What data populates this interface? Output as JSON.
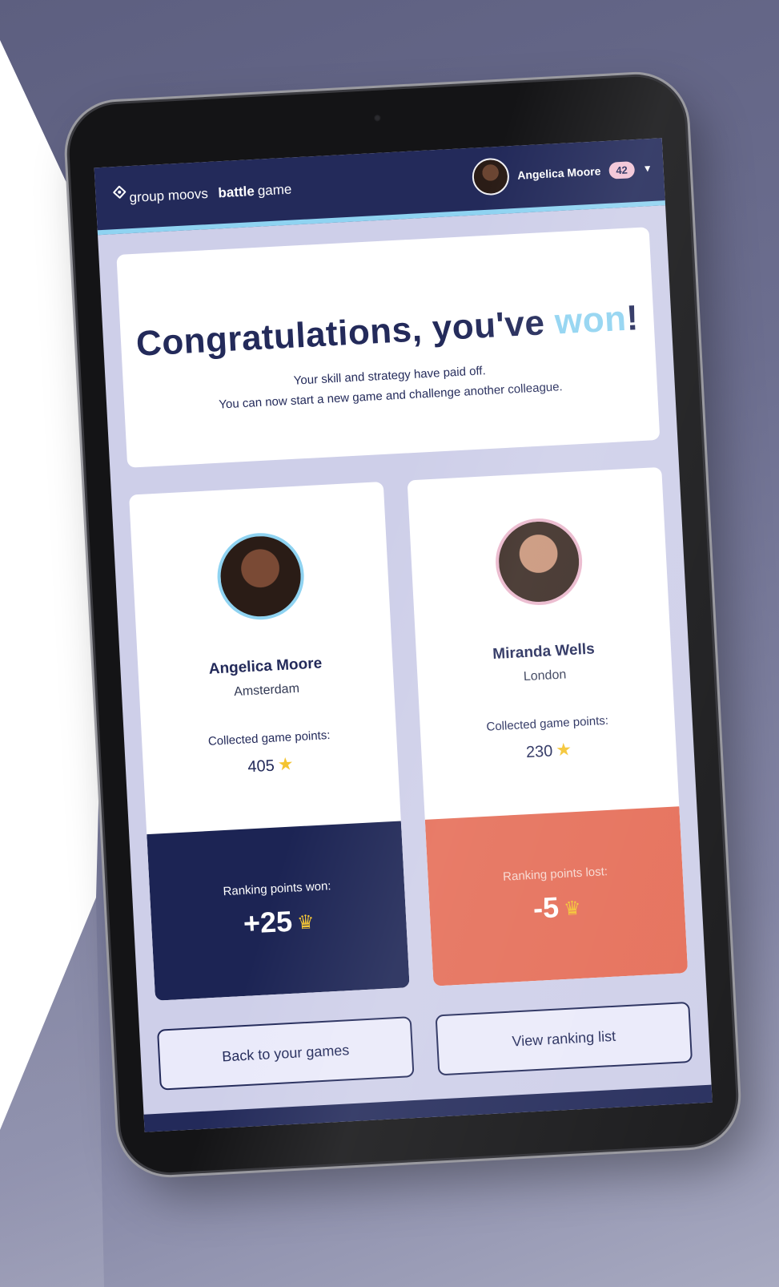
{
  "header": {
    "logo_prefix": "group moovs",
    "logo_bold": "battle",
    "logo_suffix": "game",
    "user_name": "Angelica Moore",
    "badge_count": "42"
  },
  "hero": {
    "title_main": "Congratulations, you've ",
    "title_accent": "won",
    "title_end": "!",
    "subtitle_line1": "Your skill and strategy have paid off.",
    "subtitle_line2": "You can now start a new game and challenge another colleague."
  },
  "players": [
    {
      "name": "Angelica Moore",
      "city": "Amsterdam",
      "points_label": "Collected game points:",
      "points_value": "405",
      "ranking_label": "Ranking points won:",
      "ranking_value": "+25"
    },
    {
      "name": "Miranda Wells",
      "city": "London",
      "points_label": "Collected game points:",
      "points_value": "230",
      "ranking_label": "Ranking points lost:",
      "ranking_value": "-5"
    }
  ],
  "buttons": {
    "back_label": "Back to your games",
    "ranking_label": "View ranking list"
  },
  "icons": {
    "points": "star-icon",
    "ranking": "crown-icon",
    "user_menu": "chevron-down-icon"
  },
  "colors": {
    "navy": "#232a5a",
    "accent_blue": "#8fd3f1",
    "won_panel": "#1c2454",
    "lost_panel": "#e56d57",
    "gold": "#f4c430",
    "screen_bg": "#cecfe9"
  }
}
